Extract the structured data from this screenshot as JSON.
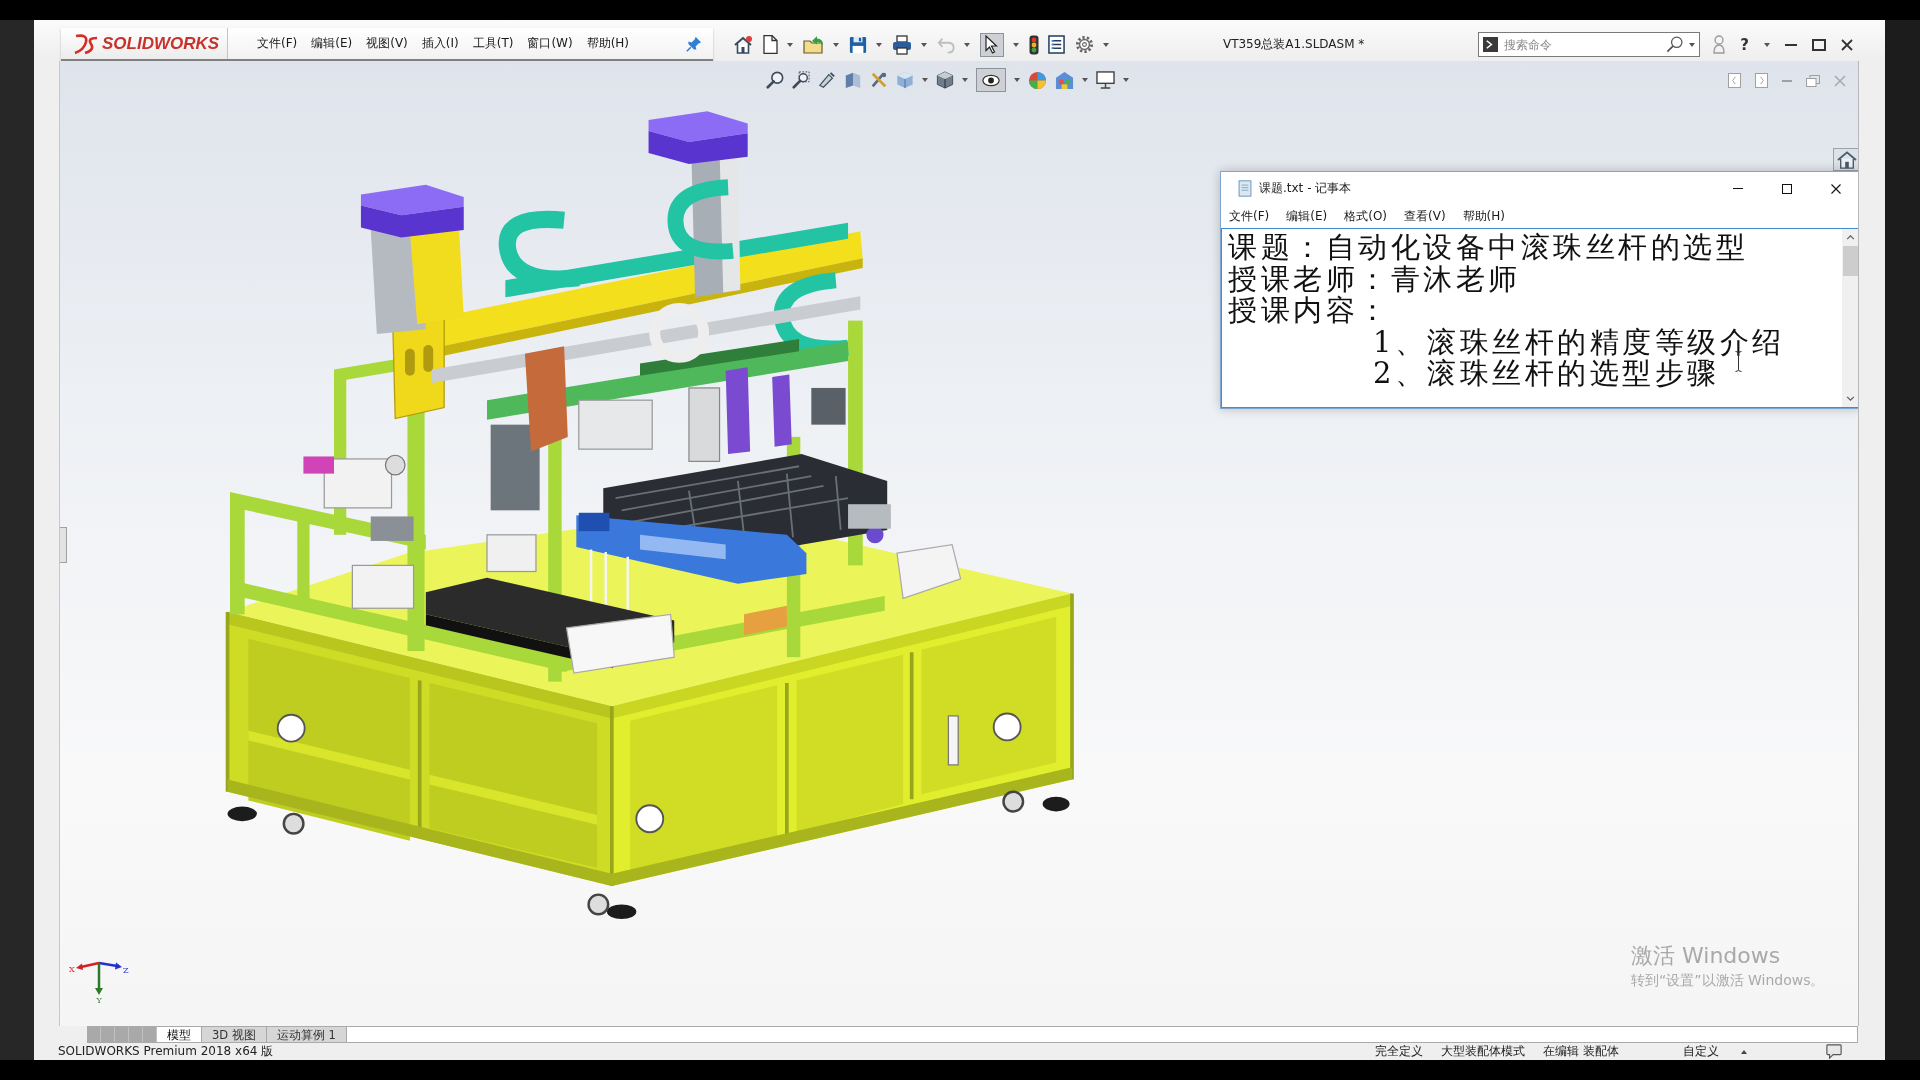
{
  "app": {
    "logo": "SOLIDWORKS",
    "menu": [
      "文件(F)",
      "编辑(E)",
      "视图(V)",
      "插入(I)",
      "工具(T)",
      "窗口(W)",
      "帮助(H)"
    ],
    "document_title": "VT359总装A1.SLDASM *",
    "search": {
      "placeholder": "搜索命令"
    },
    "help_label": "?"
  },
  "toolbar": {
    "undo": {
      "disabled": true
    },
    "select": {
      "pressed": true
    }
  },
  "view_toolbar": {
    "hide_show": {
      "pressed": true
    }
  },
  "notepad": {
    "title": "课题.txt - 记事本",
    "menu": [
      "文件(F)",
      "编辑(E)",
      "格式(O)",
      "查看(V)",
      "帮助(H)"
    ],
    "lines": [
      {
        "text": "课题：自动化设备中滚珠丝杆的选型"
      },
      {
        "text": "授课老师：青沐老师"
      },
      {
        "text": "授课内容：",
        "children": [
          {
            "text": "1、滚珠丝杆的精度等级介绍"
          },
          {
            "text": "2、滚珠丝杆的选型步骤"
          }
        ]
      }
    ]
  },
  "triad": {
    "x_label": "X",
    "y_label": "Y",
    "z_label": "Z"
  },
  "activation_notice": {
    "title": "激活 Windows",
    "message": "转到“设置”以激活 Windows。"
  },
  "tabs": [
    {
      "label": "模型",
      "selected": true
    },
    {
      "label": "3D 视图",
      "selected": false
    },
    {
      "label": "运动算例 1",
      "selected": false
    }
  ],
  "status_bar": {
    "product": "SOLIDWORKS Premium 2018 x64 版",
    "items": [
      "完全定义",
      "大型装配体模式",
      "在编辑 装配体",
      "自定义"
    ]
  }
}
